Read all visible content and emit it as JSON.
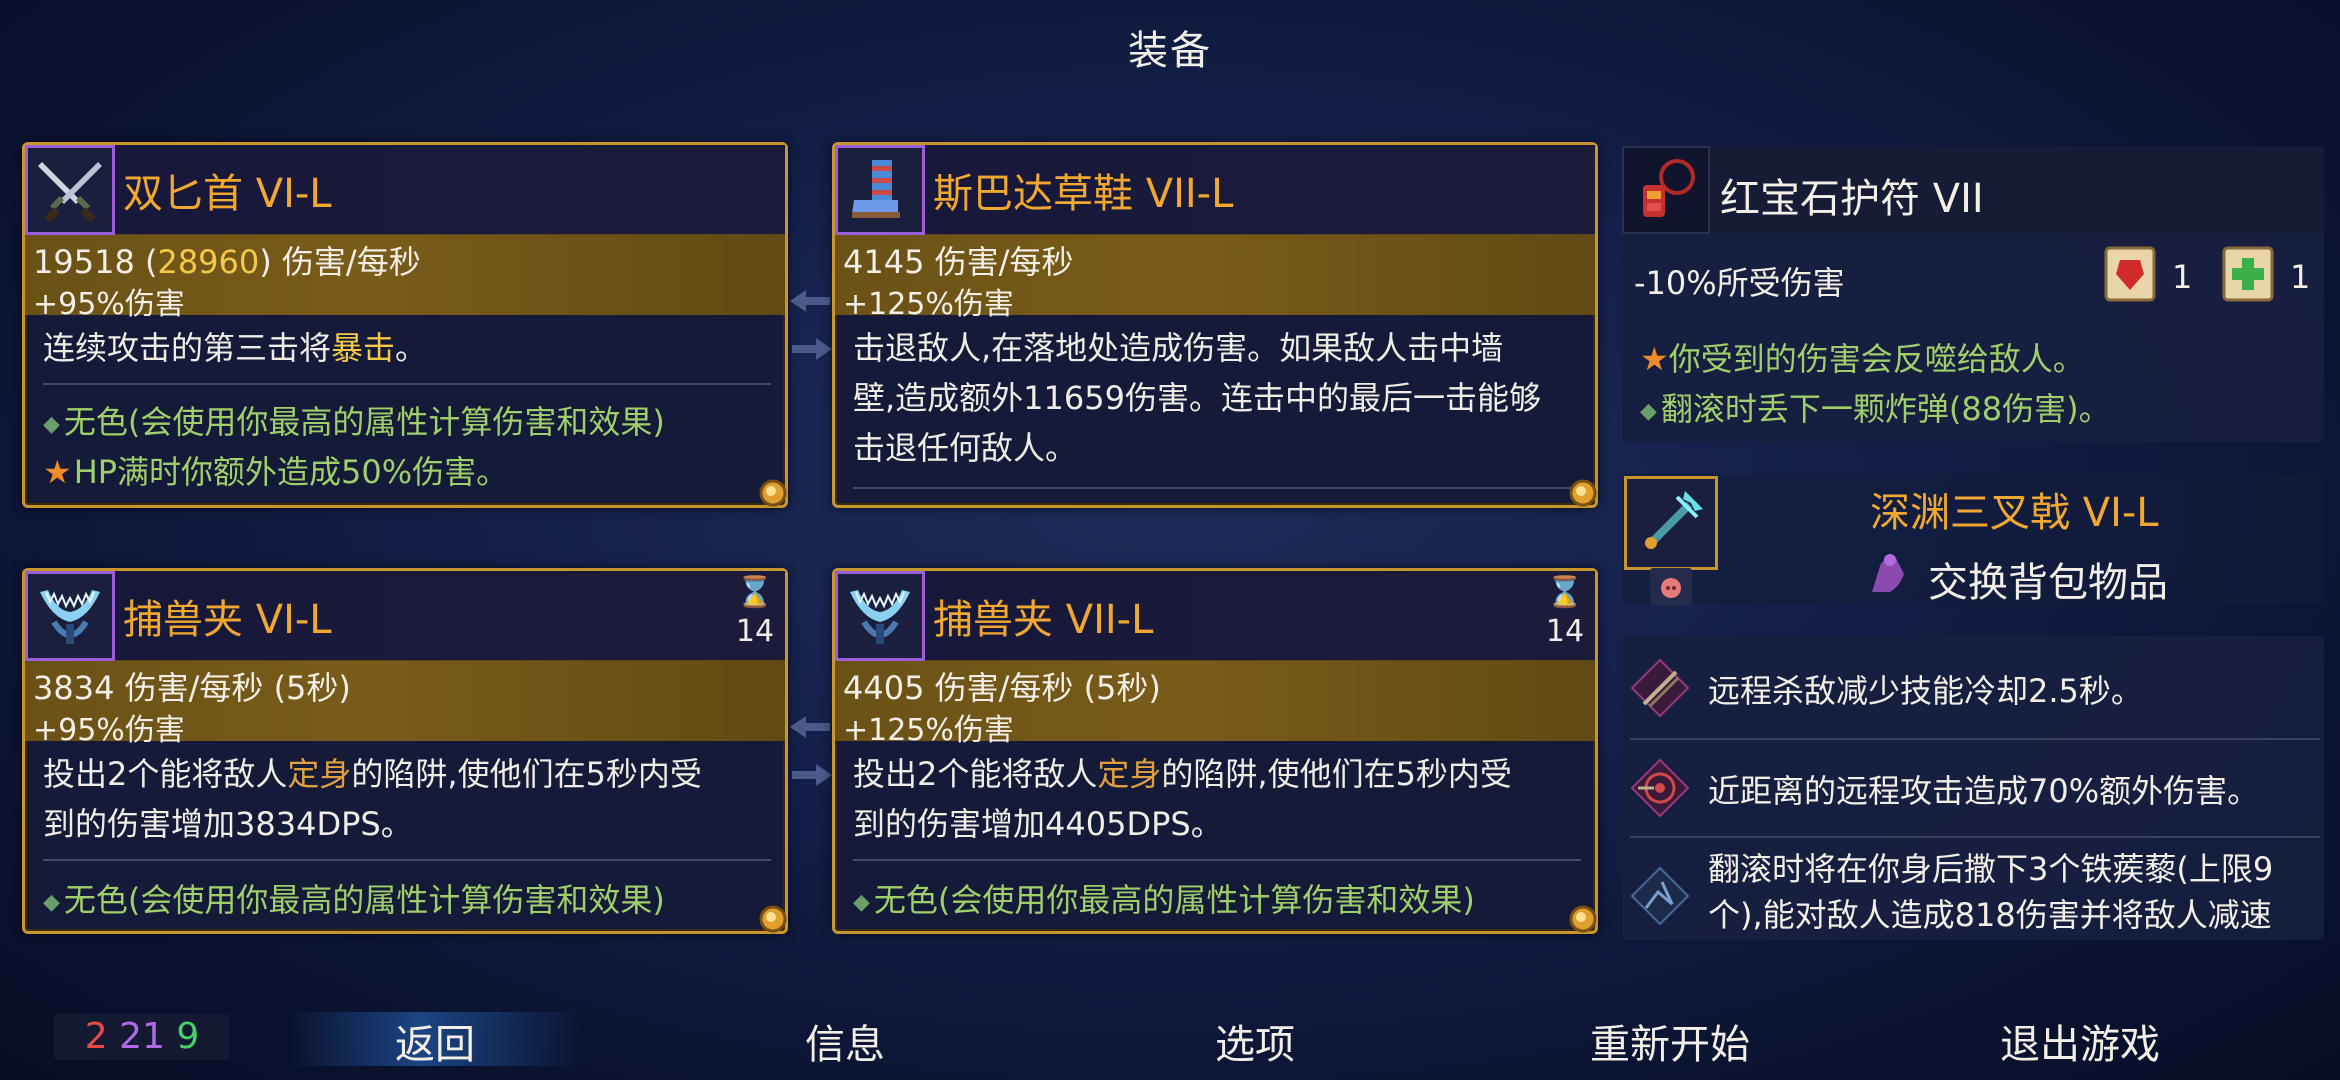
{
  "screen_title": "装备",
  "cards": [
    {
      "name": "双匕首 VI-L",
      "dps_base": "19518",
      "dps_open": " (",
      "dps_high": "28960",
      "dps_close": ") 伤害/每秒",
      "bonus": "+95%伤害",
      "desc_pre": "连续攻击的第三击将",
      "desc_kw": "暴击",
      "desc_post": "。",
      "trait1": "无色(会使用你最高的属性计算伤害和效果)",
      "trait2": "HP满时你额外造成50%伤害。",
      "icon": "twin-daggers-icon"
    },
    {
      "name": "斯巴达草鞋 VII-L",
      "dps": "4145 伤害/每秒",
      "bonus": "+125%伤害",
      "desc_line1": "击退敌人,在落地处造成伤害。如果敌人击中墙",
      "desc_line2": "壁,造成额外11659伤害。连击中的最后一击能够",
      "desc_line3": "击退任何敌人。",
      "icon": "sandal-icon"
    },
    {
      "name": "捕兽夹 VI-L",
      "dps": "3834 伤害/每秒 (5秒)",
      "bonus": "+95%伤害",
      "desc_pre": "投出2个能将敌人",
      "desc_kw": "定身",
      "desc_post": "的陷阱,使他们在5秒内受",
      "desc_line2": "到的伤害增加3834DPS。",
      "trait1": "无色(会使用你最高的属性计算伤害和效果)",
      "cooldown": "14",
      "icon": "bear-trap-icon"
    },
    {
      "name": "捕兽夹 VII-L",
      "dps": "4405 伤害/每秒 (5秒)",
      "bonus": "+125%伤害",
      "desc_pre": "投出2个能将敌人",
      "desc_kw": "定身",
      "desc_post": "的陷阱,使他们在5秒内受",
      "desc_line2": "到的伤害增加4405DPS。",
      "trait1": "无色(会使用你最高的属性计算伤害和效果)",
      "cooldown": "14",
      "icon": "bear-trap-icon"
    }
  ],
  "amulet": {
    "name": "红宝石护符 VII",
    "stat": "-10%所受伤害",
    "scroll1_count": "1",
    "scroll2_count": "1",
    "line1": "你受到的伤害会反噬给敌人。",
    "line2": "翻滚时丢下一颗炸弹(88伤害)。",
    "icon": "ruby-amulet-icon"
  },
  "backpack": {
    "weapon_name": "深渊三叉戟 VI-L",
    "swap_label": "交换背包物品",
    "icon": "trident-icon"
  },
  "mutations": [
    {
      "text": "远程杀敌减少技能冷却2.5秒。",
      "icon": "crossed-arrows-icon"
    },
    {
      "text": "近距离的远程攻击造成70%额外伤害。",
      "icon": "target-icon"
    },
    {
      "text_line1": "翻滚时将在你身后撒下3个铁蒺藜(上限9",
      "text_line2": "个),能对敌人造成818伤害并将敌人减速",
      "icon": "caltrops-icon"
    }
  ],
  "scrolls": {
    "red": "2",
    "purple": "21",
    "green": "9"
  },
  "nav": {
    "back": "返回",
    "info": "信息",
    "options": "选项",
    "restart": "重新开始",
    "quit": "退出游戏"
  },
  "colors": {
    "gold": "#f0a830",
    "trait_green": "#9fcf6a",
    "highlight": "#f5c84a",
    "card_border": "#c8962e"
  }
}
